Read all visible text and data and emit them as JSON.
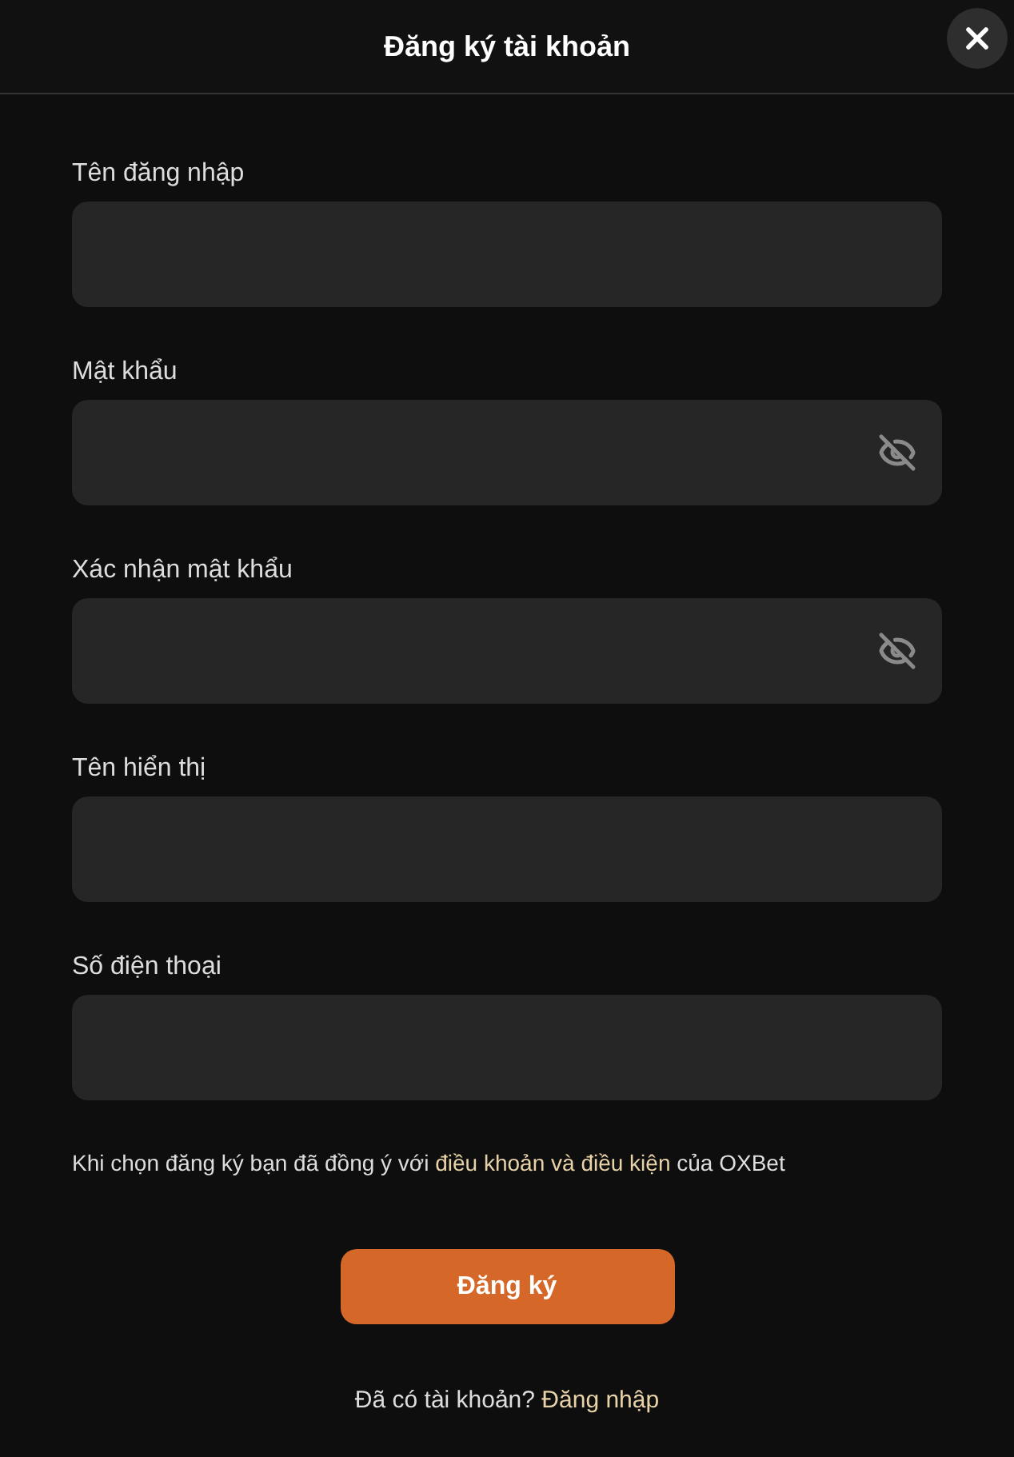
{
  "title": "Đăng ký tài khoản",
  "fields": [
    {
      "label": "Tên đăng nhập",
      "kind": "text"
    },
    {
      "label": "Mật khẩu",
      "kind": "password"
    },
    {
      "label": "Xác nhận mật khẩu",
      "kind": "password"
    },
    {
      "label": "Tên hiển thị",
      "kind": "text"
    },
    {
      "label": "Số điện thoại",
      "kind": "text"
    }
  ],
  "terms": {
    "before": "Khi chọn đăng ký bạn đã đồng ý với ",
    "link": "điều khoản và điều kiện",
    "after": " của OXBet"
  },
  "submit": "Đăng ký",
  "login_prompt": {
    "text": "Đã có tài khoản?",
    "link": "Đăng nhập"
  }
}
